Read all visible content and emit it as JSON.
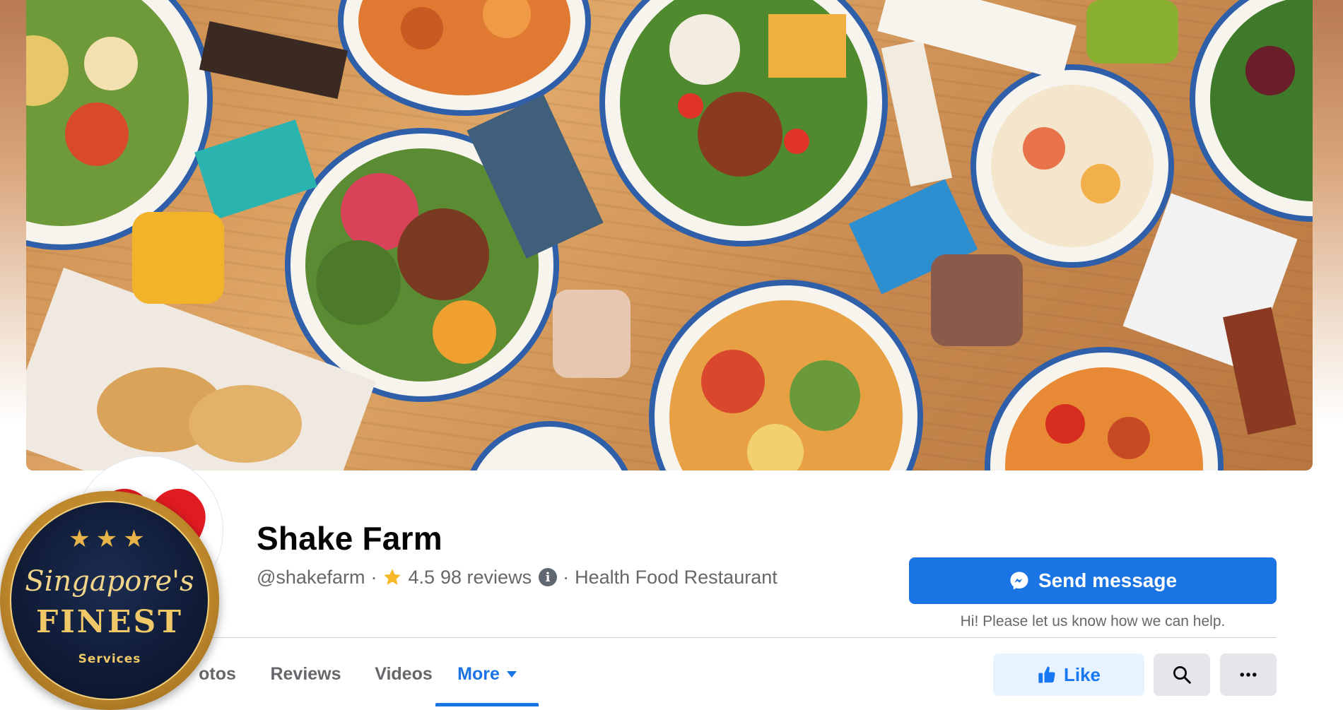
{
  "page": {
    "name": "Shake Farm",
    "handle": "@shakefarm",
    "separator": "·",
    "rating": "4.5",
    "reviews": "98 reviews",
    "category": "Health Food Restaurant"
  },
  "actions": {
    "send_message": "Send message",
    "help_text": "Hi! Please let us know how we can help.",
    "like": "Like"
  },
  "tabs": [
    {
      "label": "otos",
      "active": false
    },
    {
      "label": "Reviews",
      "active": false
    },
    {
      "label": "Videos",
      "active": false
    },
    {
      "label": "More",
      "active": true
    }
  ],
  "badge": {
    "stars": "★★★",
    "script": "Singapore's",
    "title": "FINEST",
    "subtitle": "Services"
  },
  "icons": {
    "star": "star-icon",
    "info": "info-icon",
    "messenger": "messenger-icon",
    "thumbs_up": "thumbs-up-icon",
    "search": "search-icon",
    "more": "more-horizontal-icon",
    "caret": "caret-down-icon"
  },
  "colors": {
    "primary": "#1b74e4",
    "like_bg": "#e7f3ff",
    "secondary_btn": "#e4e6eb",
    "text_secondary": "#65676b",
    "star": "#f7b928",
    "badge_gold": "#c08a2c",
    "badge_navy": "#101c38"
  }
}
